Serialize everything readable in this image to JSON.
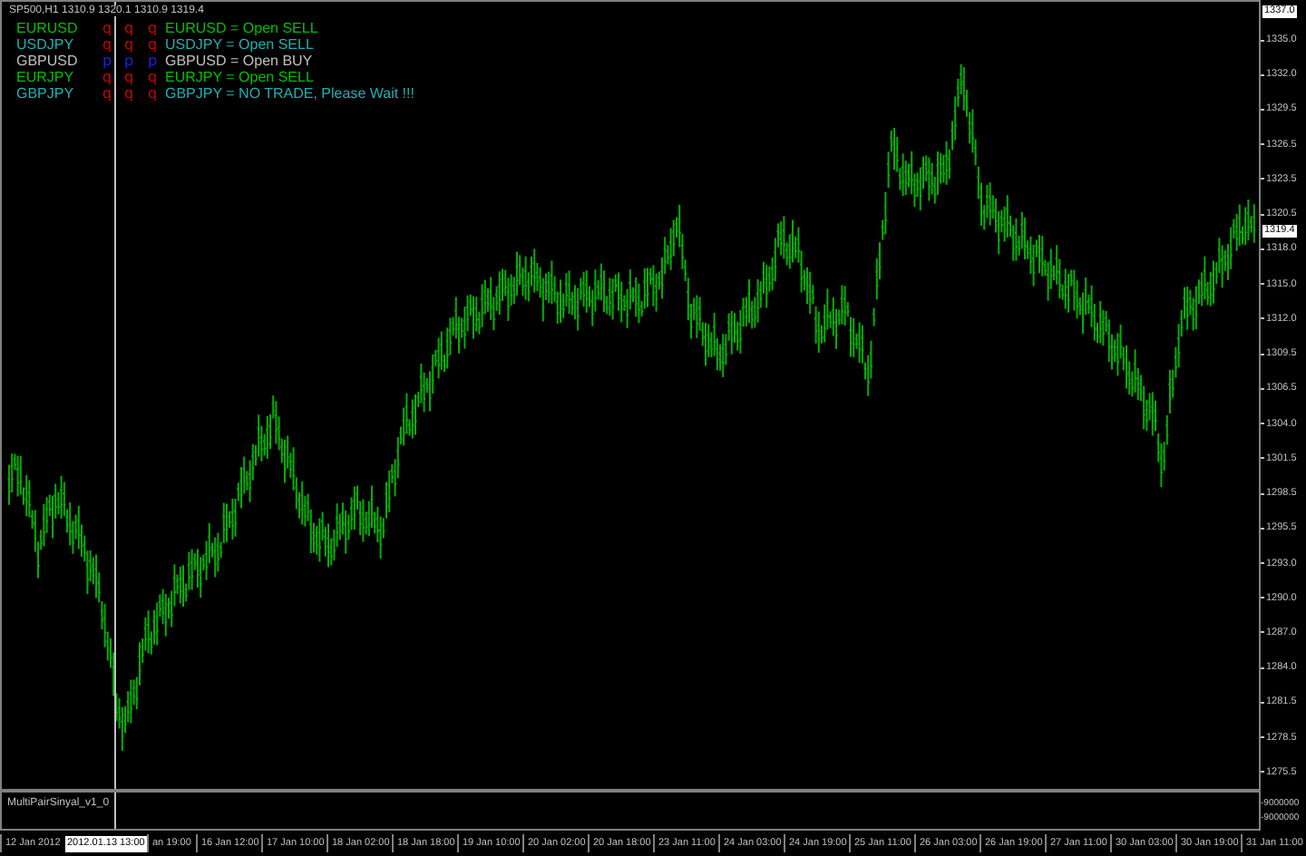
{
  "chart_header": "SP500,H1 1310.9 1320.1 1310.9 1319.4",
  "signals": [
    {
      "pair": "EURUSD",
      "color": "#00c000",
      "marks": [
        {
          "text": "q",
          "kind": "sell"
        },
        {
          "text": "q",
          "kind": "sell"
        },
        {
          "text": "q",
          "kind": "sell"
        }
      ],
      "message": "EURUSD = Open SELL"
    },
    {
      "pair": "USDJPY",
      "color": "#20b0b0",
      "marks": [
        {
          "text": "q",
          "kind": "sell"
        },
        {
          "text": "q",
          "kind": "sell"
        },
        {
          "text": "q",
          "kind": "sell"
        }
      ],
      "message": "USDJPY = Open SELL"
    },
    {
      "pair": "GBPUSD",
      "color": "#c0c0c0",
      "marks": [
        {
          "text": "p",
          "kind": "buy"
        },
        {
          "text": "p",
          "kind": "buy"
        },
        {
          "text": "p",
          "kind": "buy"
        }
      ],
      "message": "GBPUSD = Open BUY"
    },
    {
      "pair": "EURJPY",
      "color": "#00c000",
      "marks": [
        {
          "text": "q",
          "kind": "sell"
        },
        {
          "text": "q",
          "kind": "sell"
        },
        {
          "text": "q",
          "kind": "sell"
        }
      ],
      "message": "EURJPY = Open SELL"
    },
    {
      "pair": "GBPJPY",
      "color": "#20b0b0",
      "marks": [
        {
          "text": "q",
          "kind": "sell"
        },
        {
          "text": "q",
          "kind": "sell"
        },
        {
          "text": "q",
          "kind": "sell"
        }
      ],
      "message": "GBPJPY = NO TRADE, Please Wait !!!"
    }
  ],
  "price_axis": {
    "top_marker": "1337.0",
    "current_price": "1319.4",
    "labels": [
      "1335.0",
      "1332.0",
      "1329.5",
      "1326.5",
      "1323.5",
      "1320.5",
      "1318.0",
      "1315.0",
      "1312.0",
      "1309.5",
      "1306.5",
      "1304.0",
      "1301.5",
      "1298.5",
      "1295.5",
      "1293.0",
      "1290.0",
      "1287.0",
      "1284.0",
      "1281.5",
      "1278.5",
      "1275.5"
    ]
  },
  "indicator": {
    "name": "MultiPairSinyal_v1_0",
    "scale": [
      "-9000000",
      "-9000000"
    ]
  },
  "time_axis": {
    "cursor_label": "2012.01.13 13:00",
    "labels": [
      "12 Jan 2012",
      "an 19:00",
      "16 Jan 12:00",
      "17 Jan 10:00",
      "18 Jan 02:00",
      "18 Jan 18:00",
      "19 Jan 10:00",
      "20 Jan 02:00",
      "20 Jan 18:00",
      "23 Jan 11:00",
      "24 Jan 03:00",
      "24 Jan 19:00",
      "25 Jan 11:00",
      "26 Jan 03:00",
      "26 Jan 19:00",
      "27 Jan 11:00",
      "30 Jan 03:00",
      "30 Jan 19:00",
      "31 Jan 11:00"
    ]
  }
}
